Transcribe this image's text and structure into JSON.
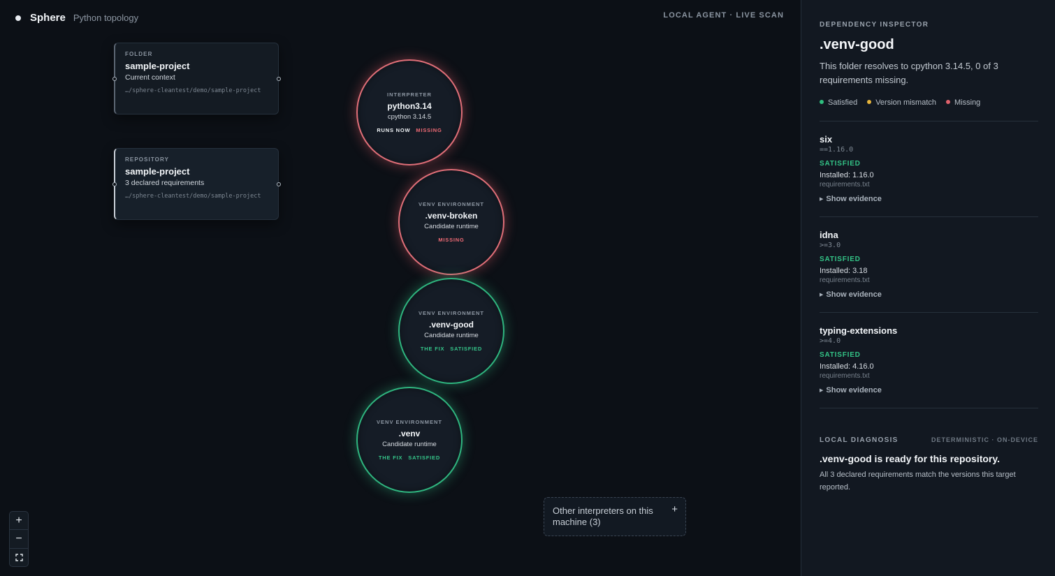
{
  "app": {
    "name": "Sphere",
    "subtitle": "Python topology",
    "status": "LOCAL AGENT · LIVE SCAN"
  },
  "cards": [
    {
      "kicker": "FOLDER",
      "title": "sample-project",
      "subtitle": "Current context",
      "path": "…/sphere-cleantest/demo/sample-project"
    },
    {
      "kicker": "REPOSITORY",
      "title": "sample-project",
      "subtitle": "3 declared requirements",
      "path": "…/sphere-cleantest/demo/sample-project"
    }
  ],
  "nodes": [
    {
      "kicker": "INTERPRETER",
      "title": "python3.14",
      "subtitle": "cpython 3.14.5",
      "tag1": "RUNS NOW",
      "tag2": "MISSING",
      "status": "missing"
    },
    {
      "kicker": "VENV ENVIRONMENT",
      "title": ".venv-broken",
      "subtitle": "Candidate runtime",
      "tag1": "",
      "tag2": "MISSING",
      "status": "missing"
    },
    {
      "kicker": "VENV ENVIRONMENT",
      "title": ".venv-good",
      "subtitle": "Candidate runtime",
      "tag1": "THE FIX",
      "tag2": "SATISFIED",
      "status": "satisfied"
    },
    {
      "kicker": "VENV ENVIRONMENT",
      "title": ".venv",
      "subtitle": "Candidate runtime",
      "tag1": "THE FIX",
      "tag2": "SATISFIED",
      "status": "satisfied"
    }
  ],
  "others": {
    "label": "Other interpreters on this machine (3)",
    "action": "+"
  },
  "zoom": {
    "in": "+",
    "out": "−",
    "fit": "⛶"
  },
  "inspector": {
    "kicker": "DEPENDENCY INSPECTOR",
    "title": ".venv-good",
    "description": "This folder resolves to cpython 3.14.5, 0 of 3 requirements missing.",
    "legend": [
      {
        "label": "Satisfied",
        "color": "#2fbf7f"
      },
      {
        "label": "Version mismatch",
        "color": "#e6b43c"
      },
      {
        "label": "Missing",
        "color": "#e0616b"
      }
    ],
    "requirements": [
      {
        "name": "six",
        "spec": "==1.16.0",
        "status": "SATISFIED",
        "installed": "Installed: 1.16.0",
        "source": "requirements.txt",
        "evidence": "Show evidence"
      },
      {
        "name": "idna",
        "spec": ">=3.0",
        "status": "SATISFIED",
        "installed": "Installed: 3.18",
        "source": "requirements.txt",
        "evidence": "Show evidence"
      },
      {
        "name": "typing-extensions",
        "spec": ">=4.0",
        "status": "SATISFIED",
        "installed": "Installed: 4.16.0",
        "source": "requirements.txt",
        "evidence": "Show evidence"
      }
    ],
    "diagnosis": {
      "kicker": "LOCAL DIAGNOSIS",
      "meta": "DETERMINISTIC · ON-DEVICE",
      "title": ".venv-good is ready for this repository.",
      "text": "All 3 declared requirements match the versions this target reported."
    }
  }
}
